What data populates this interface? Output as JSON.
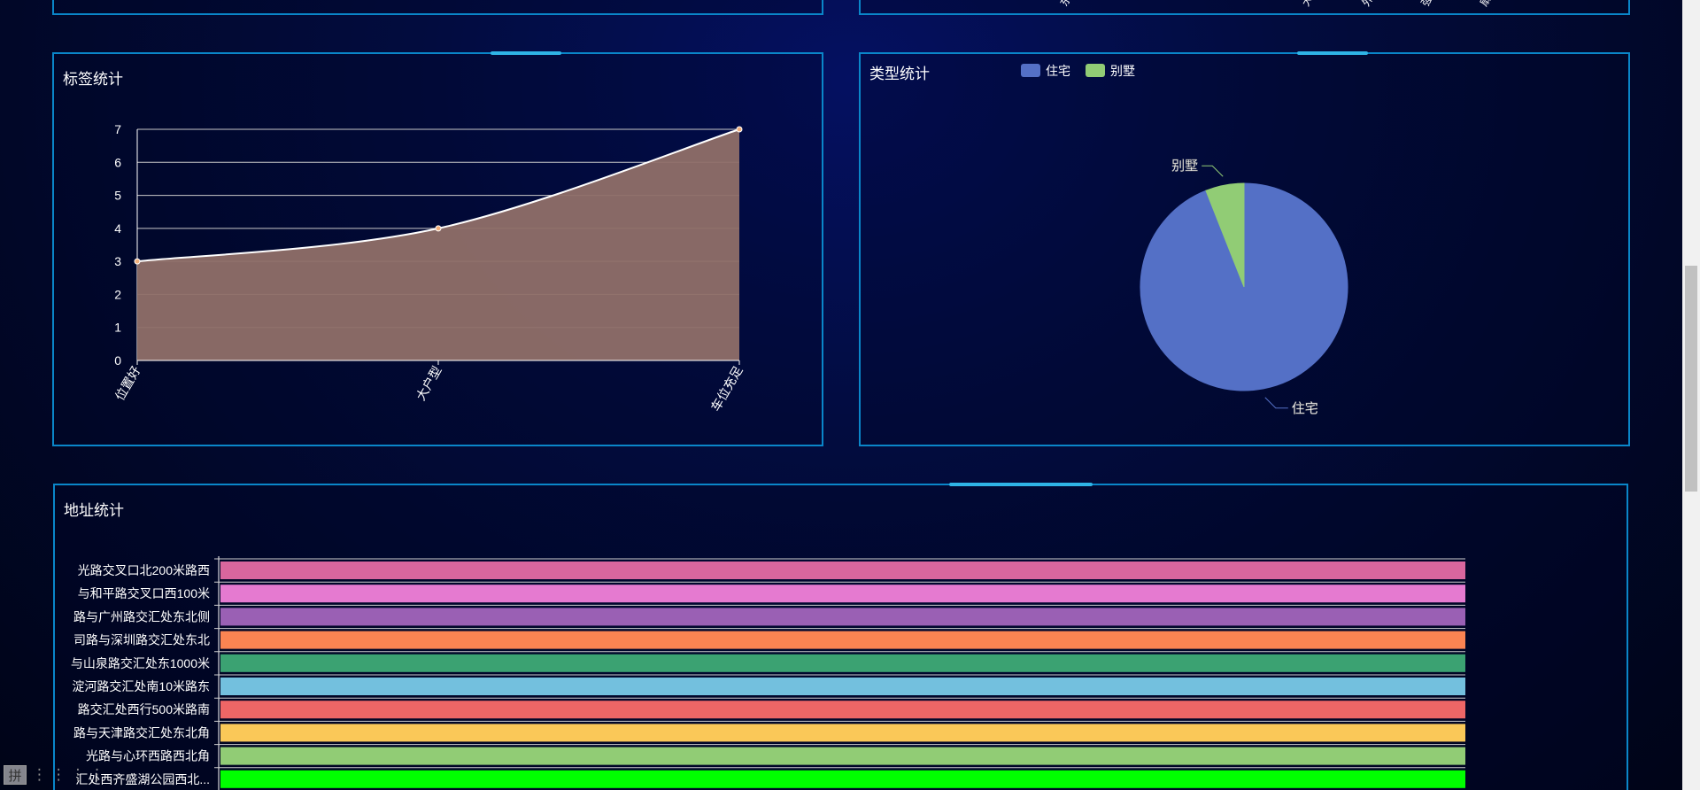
{
  "panels": {
    "tag_title": "标签统计",
    "type_title": "类型统计",
    "address_title": "地址统计"
  },
  "top_panel_fragments": [
    "东",
    "大",
    "外",
    "强",
    "扇"
  ],
  "ime": {
    "label": "拼"
  },
  "colors": {
    "border": "#0a86c9",
    "area_fill": "#8f6f68",
    "pie_residence": "#5470c6",
    "pie_villa": "#91cc75"
  },
  "chart_data": [
    {
      "type": "area",
      "title": "标签统计",
      "categories": [
        "位置好",
        "大户型",
        "车位充足"
      ],
      "values": [
        3,
        4,
        7
      ],
      "ylim": [
        0,
        7
      ],
      "yticks": [
        0,
        1,
        2,
        3,
        4,
        5,
        6,
        7
      ],
      "grid": true,
      "smooth": true
    },
    {
      "type": "pie",
      "title": "类型统计",
      "legend_position": "top",
      "slices": [
        {
          "name": "住宅",
          "value": 94,
          "color": "#5470c6"
        },
        {
          "name": "别墅",
          "value": 6,
          "color": "#91cc75"
        }
      ]
    },
    {
      "type": "bar",
      "orientation": "horizontal",
      "title": "地址统计",
      "categories": [
        "光路交叉口北200米路西",
        "与和平路交叉口西100米",
        "路与广州路交汇处东北侧",
        "司路与深圳路交汇处东北",
        "与山泉路交汇处东1000米",
        "淀河路交汇处南10米路东",
        "路交汇处西行500米路南",
        "路与天津路交汇处东北角",
        "光路与心环西路西北角",
        "汇处西齐盛湖公园西北..."
      ],
      "values": [
        1,
        1,
        1,
        1,
        1,
        1,
        1,
        1,
        1,
        1
      ],
      "colors": [
        "#d9669e",
        "#e57ad0",
        "#9a60b4",
        "#fc8452",
        "#3ba272",
        "#73c0de",
        "#ee6666",
        "#fac858",
        "#91cc75",
        "#00ff00"
      ]
    }
  ]
}
